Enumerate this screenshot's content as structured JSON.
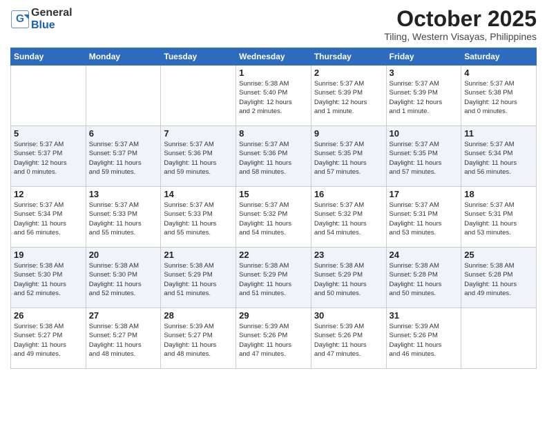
{
  "header": {
    "logo_general": "General",
    "logo_blue": "Blue",
    "month_title": "October 2025",
    "location": "Tiling, Western Visayas, Philippines"
  },
  "weekdays": [
    "Sunday",
    "Monday",
    "Tuesday",
    "Wednesday",
    "Thursday",
    "Friday",
    "Saturday"
  ],
  "weeks": [
    [
      {
        "day": "",
        "info": ""
      },
      {
        "day": "",
        "info": ""
      },
      {
        "day": "",
        "info": ""
      },
      {
        "day": "1",
        "info": "Sunrise: 5:38 AM\nSunset: 5:40 PM\nDaylight: 12 hours\nand 2 minutes."
      },
      {
        "day": "2",
        "info": "Sunrise: 5:37 AM\nSunset: 5:39 PM\nDaylight: 12 hours\nand 1 minute."
      },
      {
        "day": "3",
        "info": "Sunrise: 5:37 AM\nSunset: 5:39 PM\nDaylight: 12 hours\nand 1 minute."
      },
      {
        "day": "4",
        "info": "Sunrise: 5:37 AM\nSunset: 5:38 PM\nDaylight: 12 hours\nand 0 minutes."
      }
    ],
    [
      {
        "day": "5",
        "info": "Sunrise: 5:37 AM\nSunset: 5:37 PM\nDaylight: 12 hours\nand 0 minutes."
      },
      {
        "day": "6",
        "info": "Sunrise: 5:37 AM\nSunset: 5:37 PM\nDaylight: 11 hours\nand 59 minutes."
      },
      {
        "day": "7",
        "info": "Sunrise: 5:37 AM\nSunset: 5:36 PM\nDaylight: 11 hours\nand 59 minutes."
      },
      {
        "day": "8",
        "info": "Sunrise: 5:37 AM\nSunset: 5:36 PM\nDaylight: 11 hours\nand 58 minutes."
      },
      {
        "day": "9",
        "info": "Sunrise: 5:37 AM\nSunset: 5:35 PM\nDaylight: 11 hours\nand 57 minutes."
      },
      {
        "day": "10",
        "info": "Sunrise: 5:37 AM\nSunset: 5:35 PM\nDaylight: 11 hours\nand 57 minutes."
      },
      {
        "day": "11",
        "info": "Sunrise: 5:37 AM\nSunset: 5:34 PM\nDaylight: 11 hours\nand 56 minutes."
      }
    ],
    [
      {
        "day": "12",
        "info": "Sunrise: 5:37 AM\nSunset: 5:34 PM\nDaylight: 11 hours\nand 56 minutes."
      },
      {
        "day": "13",
        "info": "Sunrise: 5:37 AM\nSunset: 5:33 PM\nDaylight: 11 hours\nand 55 minutes."
      },
      {
        "day": "14",
        "info": "Sunrise: 5:37 AM\nSunset: 5:33 PM\nDaylight: 11 hours\nand 55 minutes."
      },
      {
        "day": "15",
        "info": "Sunrise: 5:37 AM\nSunset: 5:32 PM\nDaylight: 11 hours\nand 54 minutes."
      },
      {
        "day": "16",
        "info": "Sunrise: 5:37 AM\nSunset: 5:32 PM\nDaylight: 11 hours\nand 54 minutes."
      },
      {
        "day": "17",
        "info": "Sunrise: 5:37 AM\nSunset: 5:31 PM\nDaylight: 11 hours\nand 53 minutes."
      },
      {
        "day": "18",
        "info": "Sunrise: 5:37 AM\nSunset: 5:31 PM\nDaylight: 11 hours\nand 53 minutes."
      }
    ],
    [
      {
        "day": "19",
        "info": "Sunrise: 5:38 AM\nSunset: 5:30 PM\nDaylight: 11 hours\nand 52 minutes."
      },
      {
        "day": "20",
        "info": "Sunrise: 5:38 AM\nSunset: 5:30 PM\nDaylight: 11 hours\nand 52 minutes."
      },
      {
        "day": "21",
        "info": "Sunrise: 5:38 AM\nSunset: 5:29 PM\nDaylight: 11 hours\nand 51 minutes."
      },
      {
        "day": "22",
        "info": "Sunrise: 5:38 AM\nSunset: 5:29 PM\nDaylight: 11 hours\nand 51 minutes."
      },
      {
        "day": "23",
        "info": "Sunrise: 5:38 AM\nSunset: 5:29 PM\nDaylight: 11 hours\nand 50 minutes."
      },
      {
        "day": "24",
        "info": "Sunrise: 5:38 AM\nSunset: 5:28 PM\nDaylight: 11 hours\nand 50 minutes."
      },
      {
        "day": "25",
        "info": "Sunrise: 5:38 AM\nSunset: 5:28 PM\nDaylight: 11 hours\nand 49 minutes."
      }
    ],
    [
      {
        "day": "26",
        "info": "Sunrise: 5:38 AM\nSunset: 5:27 PM\nDaylight: 11 hours\nand 49 minutes."
      },
      {
        "day": "27",
        "info": "Sunrise: 5:38 AM\nSunset: 5:27 PM\nDaylight: 11 hours\nand 48 minutes."
      },
      {
        "day": "28",
        "info": "Sunrise: 5:39 AM\nSunset: 5:27 PM\nDaylight: 11 hours\nand 48 minutes."
      },
      {
        "day": "29",
        "info": "Sunrise: 5:39 AM\nSunset: 5:26 PM\nDaylight: 11 hours\nand 47 minutes."
      },
      {
        "day": "30",
        "info": "Sunrise: 5:39 AM\nSunset: 5:26 PM\nDaylight: 11 hours\nand 47 minutes."
      },
      {
        "day": "31",
        "info": "Sunrise: 5:39 AM\nSunset: 5:26 PM\nDaylight: 11 hours\nand 46 minutes."
      },
      {
        "day": "",
        "info": ""
      }
    ]
  ]
}
